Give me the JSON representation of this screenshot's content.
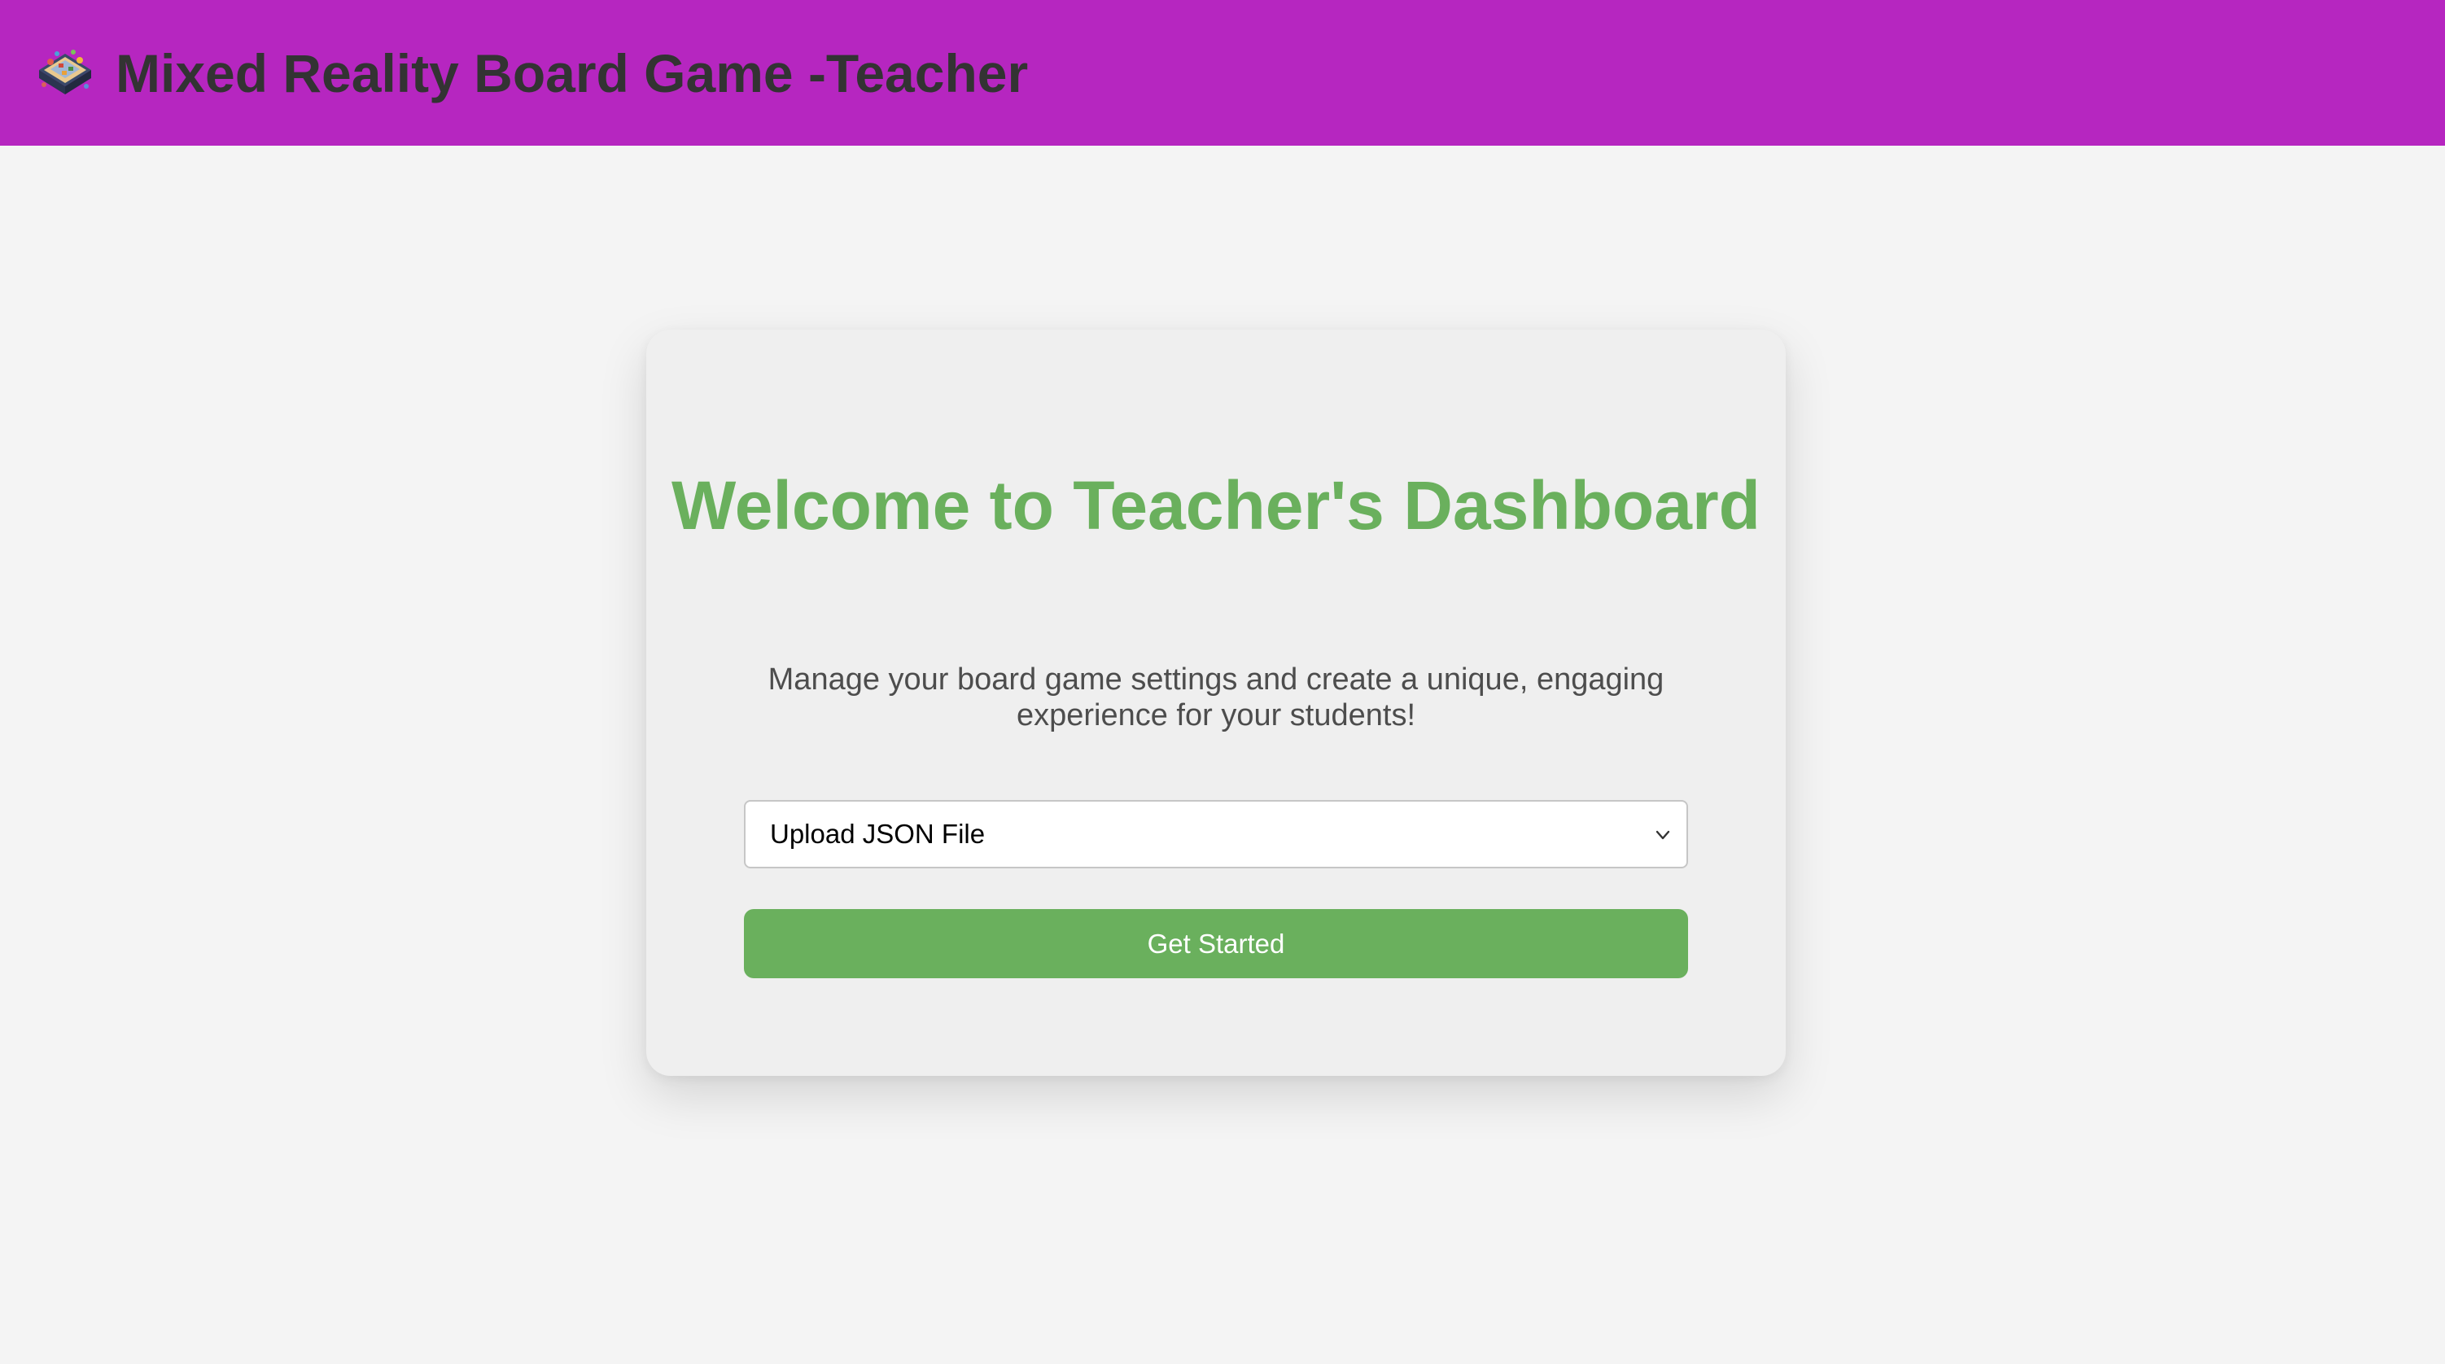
{
  "header": {
    "title": "Mixed Reality Board Game -Teacher",
    "logo_icon": "board-game-icon",
    "background_color": "#b626c0"
  },
  "card": {
    "heading": "Welcome to Teacher's Dashboard",
    "description": "Manage your board game settings and create a unique, engaging experience for your students!",
    "select": {
      "selected": "Upload JSON File",
      "icon": "chevron-down-icon"
    },
    "button_label": "Get Started",
    "accent_color": "#6ab05d"
  }
}
